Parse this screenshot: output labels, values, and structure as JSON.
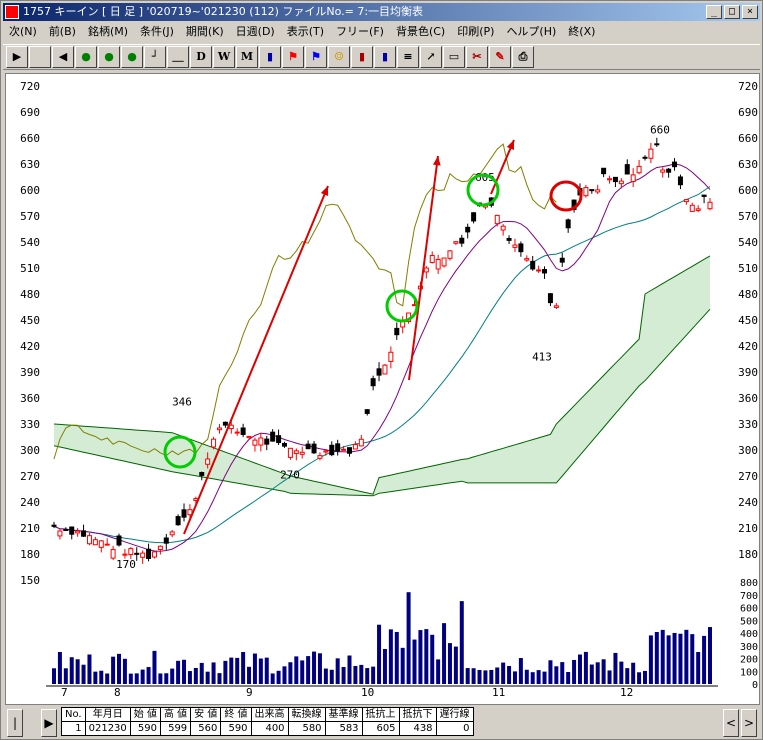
{
  "window": {
    "title": "1757 キーイン [ 日 足 ]  '020719~'021230 (112)  ファイルNo.= 7:一目均衡表",
    "buttons": [
      "_",
      "□",
      "×"
    ]
  },
  "menu": [
    "次(N)",
    "前(B)",
    "銘柄(M)",
    "条件(J)",
    "期間(K)",
    "日週(D)",
    "表示(T)",
    "フリー(F)",
    "背景色(C)",
    "印刷(P)",
    "ヘルプ(H)",
    "終(X)"
  ],
  "toolbar": {
    "buttons": [
      {
        "name": "next-arrow",
        "glyph": "▶"
      },
      {
        "name": "blank-page",
        "glyph": ""
      },
      {
        "name": "prev-arrow",
        "glyph": "◀"
      },
      {
        "name": "signal-1",
        "glyph": "●"
      },
      {
        "name": "signal-2",
        "glyph": "●"
      },
      {
        "name": "signal-3",
        "glyph": "●"
      },
      {
        "name": "line-tool",
        "glyph": "┘"
      },
      {
        "name": "hline-tool",
        "glyph": "＿"
      },
      {
        "name": "daily",
        "glyph": "D"
      },
      {
        "name": "weekly",
        "glyph": "W"
      },
      {
        "name": "monthly",
        "glyph": "M"
      },
      {
        "name": "bar-chart",
        "glyph": "▮"
      },
      {
        "name": "flag-red",
        "glyph": "⚑"
      },
      {
        "name": "flag-blue",
        "glyph": "⚑"
      },
      {
        "name": "smiley",
        "glyph": "☺"
      },
      {
        "name": "bars-small",
        "glyph": "▮"
      },
      {
        "name": "bars-blue",
        "glyph": "▮"
      },
      {
        "name": "lines-tool",
        "glyph": "≡"
      },
      {
        "name": "arrow-tool",
        "glyph": "↗"
      },
      {
        "name": "ruler-tool",
        "glyph": "▭"
      },
      {
        "name": "scissors",
        "glyph": "✂"
      },
      {
        "name": "pen",
        "glyph": "✎"
      },
      {
        "name": "printer",
        "glyph": "⎙"
      }
    ]
  },
  "colors": {
    "candle_up": "#ff0000",
    "candle_down": "#000000",
    "tenkan": "#800080",
    "kijun": "#008080",
    "span_a": "#006400",
    "span_b": "#006400",
    "chikou": "#808000",
    "cloud_dots": "#008000",
    "volume": "#000080",
    "arrow": "#dd0000",
    "circle_green": "#00cc00",
    "circle_red": "#dd0000"
  },
  "price_axis": {
    "ticks": [
      "720",
      "690",
      "660",
      "630",
      "600",
      "570",
      "540",
      "510",
      "480",
      "450",
      "420",
      "390",
      "360",
      "330",
      "300",
      "270",
      "240",
      "210",
      "180",
      "150"
    ]
  },
  "right_axis": {
    "ticks": [
      "720",
      "690",
      "660",
      "630",
      "600",
      "570",
      "540",
      "510",
      "480",
      "450",
      "420",
      "390",
      "360",
      "330",
      "300",
      "270",
      "240",
      "210",
      "180"
    ]
  },
  "volume_axis": {
    "ticks": [
      "800",
      "700",
      "600",
      "500",
      "400",
      "300",
      "200",
      "100",
      "0"
    ]
  },
  "month_labels": [
    "7",
    "8",
    "9",
    "10",
    "11",
    "12"
  ],
  "annotations": {
    "low1": "170",
    "high1": "346",
    "mid1": "270",
    "high2": "605",
    "low2": "413",
    "high3": "660"
  },
  "chart_data": {
    "type": "candlestick",
    "period": "'020719~'021230",
    "ylim": [
      150,
      720
    ],
    "volume_ylim": [
      0,
      800
    ]
  },
  "table": {
    "headers": [
      "No.",
      "年月日",
      "始 値",
      "高 値",
      "安 値",
      "終 値",
      "出来高",
      "転換線",
      "基準線",
      "抵抗上",
      "抵抗下",
      "遅行線"
    ],
    "row": [
      "1",
      "021230",
      "590",
      "599",
      "560",
      "590",
      "400",
      "580",
      "583",
      "605",
      "438",
      "0"
    ]
  },
  "scroll": {
    "left": "|",
    "right": "▶",
    "back": "<",
    "fwd": ">"
  }
}
